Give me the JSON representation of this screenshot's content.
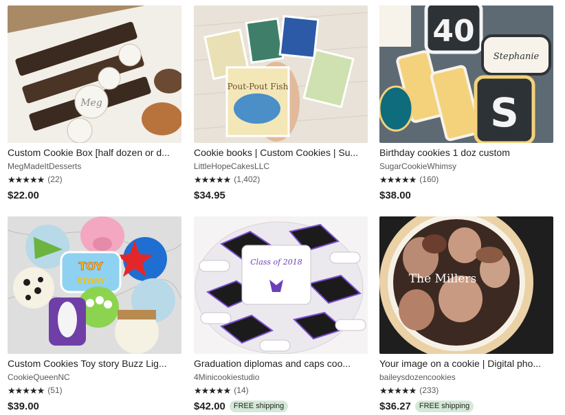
{
  "listings": [
    {
      "title": "Custom Cookie Box [half dozen or d...",
      "shop": "MegMadeItDesserts",
      "stars": "★★★★★",
      "reviews": "(22)",
      "price": "$22.00",
      "shipping": "",
      "image_icon": "cookie-box-photo",
      "label_text": "Meg"
    },
    {
      "title": "Cookie books | Custom Cookies | Su...",
      "shop": "LittleHopeCakesLLC",
      "stars": "★★★★★",
      "reviews": "(1,402)",
      "price": "$34.95",
      "shipping": "",
      "image_icon": "book-cookies-photo",
      "label_text": "Pout-Pout Fish"
    },
    {
      "title": "Birthday cookies 1 doz custom",
      "shop": "SugarCookieWhimsy",
      "stars": "★★★★★",
      "reviews": "(160)",
      "price": "$38.00",
      "shipping": "",
      "image_icon": "birthday-cookies-photo",
      "label_text": "Stephanie"
    },
    {
      "title": "Custom Cookies Toy story Buzz Lig...",
      "shop": "CookieQueenNC",
      "stars": "★★★★★",
      "reviews": "(51)",
      "price": "$39.00",
      "shipping": "",
      "image_icon": "toy-story-cookies-photo",
      "label_text": "TOY STORY"
    },
    {
      "title": "Graduation diplomas and caps coo...",
      "shop": "4Minicookiestudio",
      "stars": "★★★★★",
      "reviews": "(14)",
      "price": "$42.00",
      "shipping": "FREE shipping",
      "image_icon": "graduation-cookies-photo",
      "label_text": "Class of 2018"
    },
    {
      "title": "Your image on a cookie | Digital pho...",
      "shop": "baileysdozencookies",
      "stars": "★★★★★",
      "reviews": "(233)",
      "price": "$36.27",
      "shipping": "FREE shipping",
      "image_icon": "photo-cookie-photo",
      "label_text": "The Millers"
    }
  ],
  "colors": {
    "badge_bg": "#d4e9d7",
    "text": "#222222",
    "muted": "#595959"
  }
}
